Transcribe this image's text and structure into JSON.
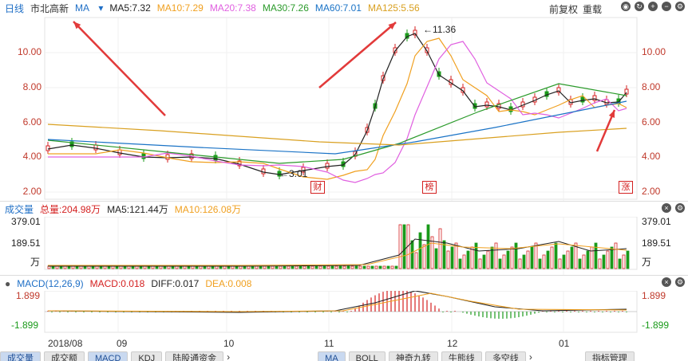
{
  "header": {
    "period": "日线",
    "stock_name": "市北高新",
    "indicator": "MA",
    "ma5": "MA5:7.32",
    "ma10": "MA10:7.29",
    "ma20": "MA20:7.38",
    "ma30": "MA30:7.26",
    "ma60": "MA60:7.01",
    "ma125": "MA125:5.56",
    "adjust": "前复权",
    "reset": "重载"
  },
  "colors": {
    "ma5": "#222222",
    "ma10": "#f0a020",
    "ma20": "#e060e0",
    "ma30": "#2a9a2a",
    "ma60": "#1a73c6",
    "ma125": "#d9a020",
    "up": "#d42020",
    "down": "#1a9a1a"
  },
  "price_panel": {
    "y_labels": [
      "10.00",
      "8.00",
      "6.00",
      "4.00",
      "2.00"
    ],
    "high_mark": "11.36",
    "low_mark": "3.01",
    "tags": [
      "财",
      "榜",
      "涨"
    ]
  },
  "volume_panel": {
    "title": "成交量",
    "total": "总量:204.98万",
    "ma5": "MA5:121.44万",
    "ma10": "MA10:126.08万",
    "y_labels": [
      "379.01",
      "189.51",
      "万"
    ]
  },
  "macd_panel": {
    "title": "MACD(12,26,9)",
    "macd": "MACD:0.018",
    "diff": "DIFF:0.017",
    "dea": "DEA:0.008",
    "y_top": "1.899",
    "y_bottom": "-1.899"
  },
  "x_labels": [
    "2018/08",
    "09",
    "10",
    "11",
    "12",
    "01"
  ],
  "bottom_tabs": {
    "left": [
      "成交量",
      "成交额",
      "MACD",
      "KDJ",
      "陆股通资金"
    ],
    "right": [
      "MA",
      "BOLL",
      "神奇九转",
      "牛熊线",
      "多空线"
    ],
    "manage": "指标管理"
  }
}
